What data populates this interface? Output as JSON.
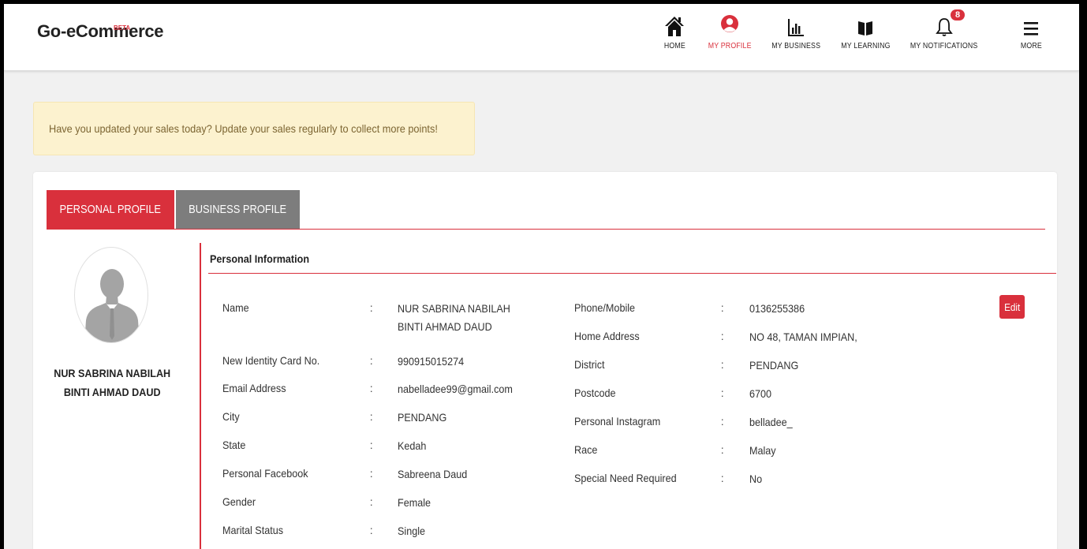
{
  "brand": {
    "name": "Go-eCommerce",
    "tag": "BETA"
  },
  "nav": [
    {
      "label": "HOME",
      "icon": "home-icon"
    },
    {
      "label": "MY PROFILE",
      "icon": "user-icon",
      "active": true
    },
    {
      "label": "MY BUSINESS",
      "icon": "bar-chart-icon"
    },
    {
      "label": "MY LEARNING",
      "icon": "book-icon"
    },
    {
      "label": "MY NOTIFICATIONS",
      "icon": "bell-icon",
      "badge": "8"
    },
    {
      "label": "MORE",
      "icon": "menu-icon"
    }
  ],
  "alert": {
    "text": "Have you updated your sales today? Update your sales regularly to collect more points!"
  },
  "tabs": [
    {
      "label": "PERSONAL PROFILE",
      "active": true
    },
    {
      "label": "BUSINESS PROFILE"
    }
  ],
  "profile": {
    "name_line1": "NUR SABRINA NABILAH",
    "name_line2": "BINTI AHMAD DAUD"
  },
  "section": {
    "title": "Personal Information",
    "edit_label": "Edit"
  },
  "separator": ":",
  "left_fields": [
    {
      "label": "Name",
      "value": "NUR SABRINA NABILAH",
      "value2": "BINTI AHMAD DAUD"
    },
    {
      "label": "New Identity Card No.",
      "value": "990915015274"
    },
    {
      "label": "Email Address",
      "value": "nabelladee99@gmail.com"
    },
    {
      "label": "City",
      "value": "PENDANG"
    },
    {
      "label": "State",
      "value": "Kedah"
    },
    {
      "label": "Personal Facebook",
      "value": "Sabreena Daud"
    },
    {
      "label": "Gender",
      "value": "Female"
    },
    {
      "label": "Marital Status",
      "value": "Single"
    }
  ],
  "right_fields": [
    {
      "label": "Phone/Mobile",
      "value": "0136255386"
    },
    {
      "label": "Home Address",
      "value": "NO 48, TAMAN IMPIAN,"
    },
    {
      "label": "District",
      "value": "PENDANG"
    },
    {
      "label": "Postcode",
      "value": "6700"
    },
    {
      "label": "Personal Instagram",
      "value": "belladee_"
    },
    {
      "label": "Race",
      "value": "Malay"
    },
    {
      "label": "Special Need Required",
      "value": "No"
    }
  ],
  "colors": {
    "accent": "#d9303c",
    "tab_inactive": "#7d7d7d",
    "alert_bg": "#fcf2cf",
    "alert_text": "#7c6532"
  }
}
